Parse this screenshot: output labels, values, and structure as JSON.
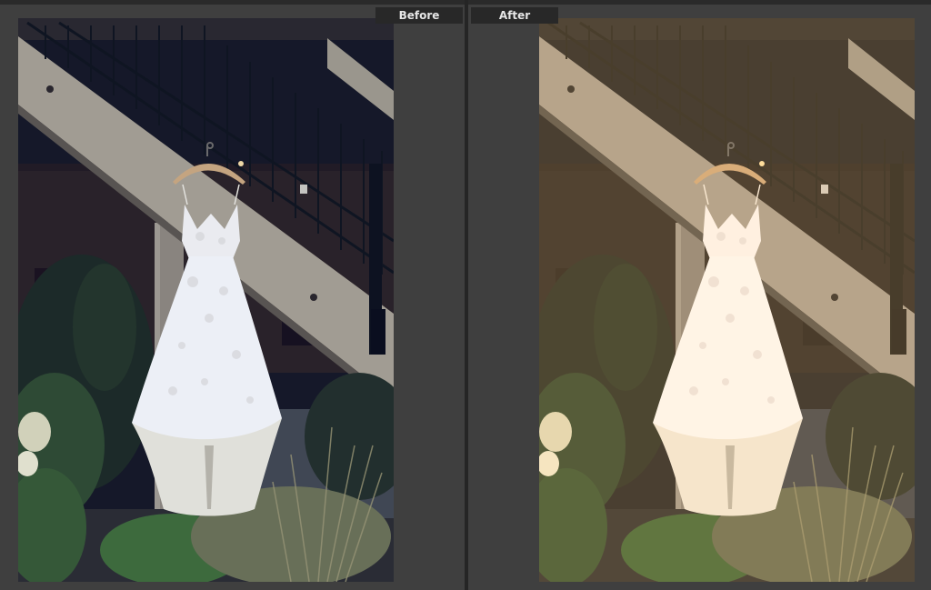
{
  "view": {
    "mode": "before-after-compare",
    "before_label": "Before",
    "after_label": "After"
  },
  "photo": {
    "subject": "wedding-dress-on-hanger",
    "before_tone": "cool",
    "after_tone": "warm"
  },
  "colors": {
    "ui_background": "#3d3d3d",
    "tab_background": "#282828",
    "tab_text": "#e6e6e6",
    "before_shadow": "#14171c",
    "after_shadow": "#1e1914"
  }
}
